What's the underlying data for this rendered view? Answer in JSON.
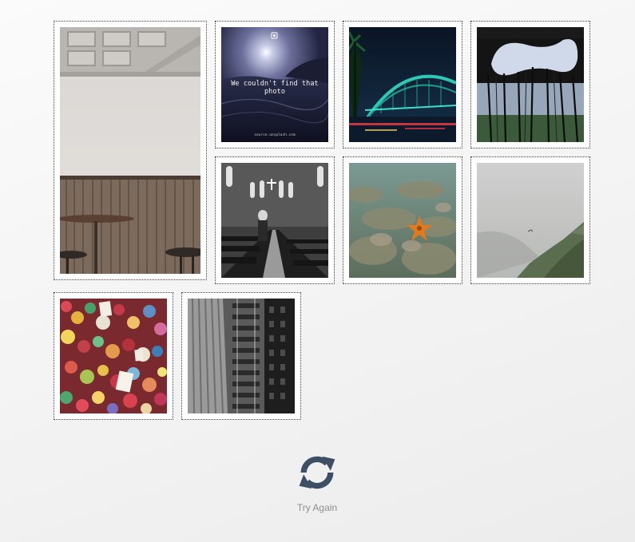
{
  "gallery": {
    "photos": [
      {
        "subject": "cafe interior with wood paneling"
      },
      {
        "subject": "moonlit waves",
        "caption": "We couldn't find that photo",
        "source": "source.unsplash.com"
      },
      {
        "subject": "harbour bridge at night"
      },
      {
        "subject": "curved roof opening"
      },
      {
        "subject": "cathedral interior"
      },
      {
        "subject": "coral reef with starfish"
      },
      {
        "subject": "misty mountain"
      },
      {
        "subject": "gum wall"
      },
      {
        "subject": "skyscraper black and white"
      }
    ]
  },
  "retry": {
    "label": "Try Again",
    "icon": "refresh-icon"
  },
  "colors": {
    "retry_icon": "#3d4f65",
    "retry_label": "#8e8e8e",
    "tile_border": "#3a3a3a"
  }
}
